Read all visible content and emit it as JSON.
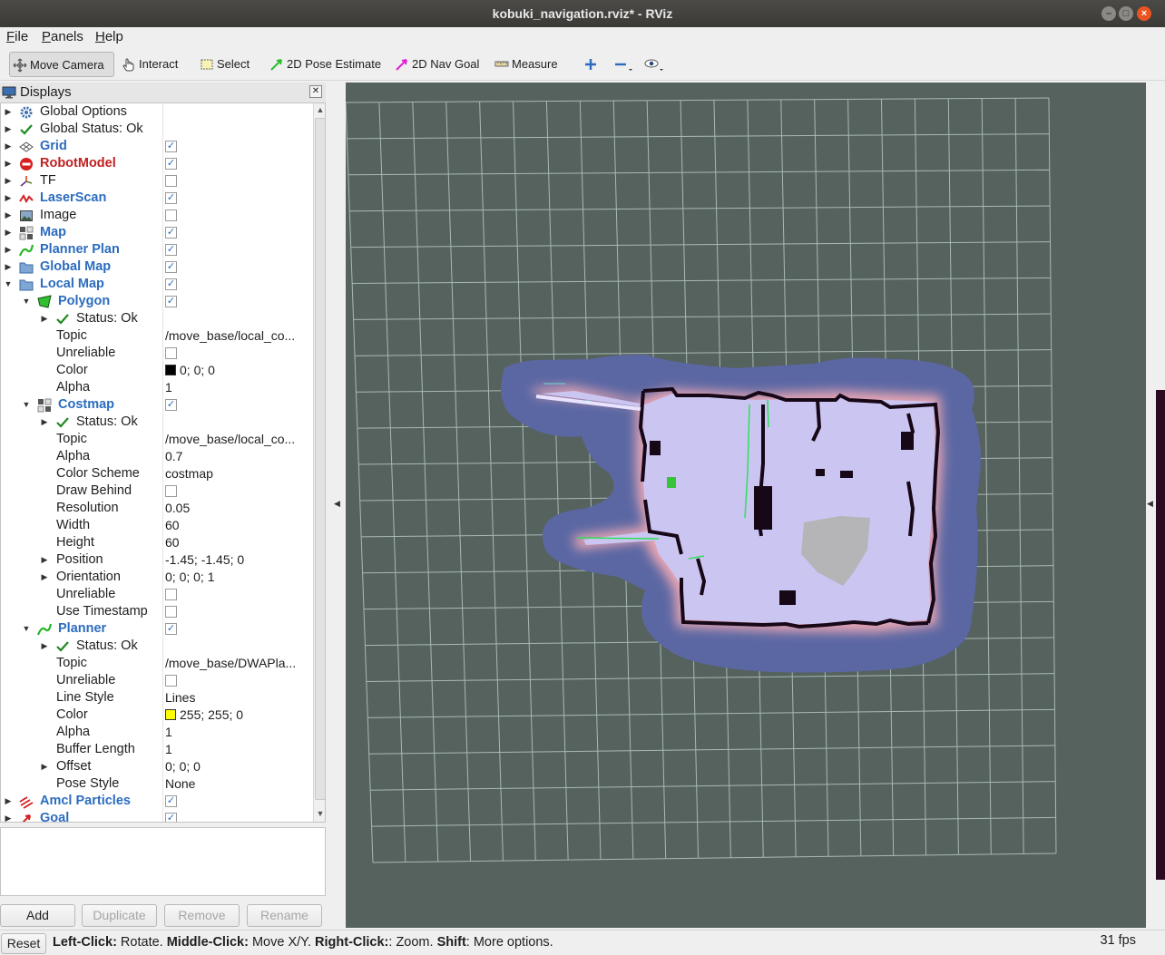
{
  "window": {
    "title": "kobuki_navigation.rviz* - RViz"
  },
  "menubar": [
    {
      "key": "F",
      "rest": "ile"
    },
    {
      "key": "P",
      "rest": "anels"
    },
    {
      "key": "H",
      "rest": "elp"
    }
  ],
  "toolbar": {
    "move_camera": "Move Camera",
    "interact": "Interact",
    "select": "Select",
    "pose_estimate": "2D Pose Estimate",
    "nav_goal": "2D Nav Goal",
    "measure": "Measure",
    "active_tool": "Move Camera"
  },
  "displays": {
    "title": "Displays",
    "rows": [
      {
        "depth": 0,
        "arrow": "right",
        "icon": "gear-icon",
        "label": "Global Options",
        "style": "",
        "value": "",
        "check": null
      },
      {
        "depth": 0,
        "arrow": "right",
        "icon": "check-icon",
        "label": "Global Status: Ok",
        "style": "",
        "value": "",
        "check": null
      },
      {
        "depth": 0,
        "arrow": "right",
        "icon": "grid-icon",
        "label": "Grid",
        "style": "blue",
        "value": "",
        "check": true
      },
      {
        "depth": 0,
        "arrow": "right",
        "icon": "robot-error-icon",
        "label": "RobotModel",
        "style": "red",
        "value": "",
        "check": true
      },
      {
        "depth": 0,
        "arrow": "right",
        "icon": "tf-icon",
        "label": "TF",
        "style": "",
        "value": "",
        "check": false
      },
      {
        "depth": 0,
        "arrow": "right",
        "icon": "laserscan-icon",
        "label": "LaserScan",
        "style": "blue",
        "value": "",
        "check": true
      },
      {
        "depth": 0,
        "arrow": "right",
        "icon": "image-icon",
        "label": "Image",
        "style": "",
        "value": "",
        "check": false
      },
      {
        "depth": 0,
        "arrow": "right",
        "icon": "map-icon",
        "label": "Map",
        "style": "blue",
        "value": "",
        "check": true
      },
      {
        "depth": 0,
        "arrow": "right",
        "icon": "path-icon",
        "label": "Planner Plan",
        "style": "blue",
        "value": "",
        "check": true
      },
      {
        "depth": 0,
        "arrow": "right",
        "icon": "folder-icon",
        "label": "Global Map",
        "style": "blue",
        "value": "",
        "check": true
      },
      {
        "depth": 0,
        "arrow": "down",
        "icon": "folder-icon",
        "label": "Local Map",
        "style": "blue",
        "value": "",
        "check": true
      },
      {
        "depth": 1,
        "arrow": "down",
        "icon": "polygon-icon",
        "label": "Polygon",
        "style": "blue",
        "value": "",
        "check": true
      },
      {
        "depth": 2,
        "arrow": "right",
        "icon": "check-icon",
        "label": "Status: Ok",
        "style": "",
        "value": "",
        "check": null
      },
      {
        "depth": 2,
        "arrow": "",
        "icon": "",
        "label": "Topic",
        "style": "",
        "value": "/move_base/local_co...",
        "check": null
      },
      {
        "depth": 2,
        "arrow": "",
        "icon": "",
        "label": "Unreliable",
        "style": "",
        "value": "",
        "check": false
      },
      {
        "depth": 2,
        "arrow": "",
        "icon": "",
        "label": "Color",
        "style": "",
        "value": "0; 0; 0",
        "swatch": "#000000",
        "check": null
      },
      {
        "depth": 2,
        "arrow": "",
        "icon": "",
        "label": "Alpha",
        "style": "",
        "value": "1",
        "check": null
      },
      {
        "depth": 1,
        "arrow": "down",
        "icon": "map-icon",
        "label": "Costmap",
        "style": "blue",
        "value": "",
        "check": true
      },
      {
        "depth": 2,
        "arrow": "right",
        "icon": "check-icon",
        "label": "Status: Ok",
        "style": "",
        "value": "",
        "check": null
      },
      {
        "depth": 2,
        "arrow": "",
        "icon": "",
        "label": "Topic",
        "style": "",
        "value": "/move_base/local_co...",
        "check": null
      },
      {
        "depth": 2,
        "arrow": "",
        "icon": "",
        "label": "Alpha",
        "style": "",
        "value": "0.7",
        "check": null
      },
      {
        "depth": 2,
        "arrow": "",
        "icon": "",
        "label": "Color Scheme",
        "style": "",
        "value": "costmap",
        "check": null
      },
      {
        "depth": 2,
        "arrow": "",
        "icon": "",
        "label": "Draw Behind",
        "style": "",
        "value": "",
        "check": false
      },
      {
        "depth": 2,
        "arrow": "",
        "icon": "",
        "label": "Resolution",
        "style": "",
        "value": "0.05",
        "check": null
      },
      {
        "depth": 2,
        "arrow": "",
        "icon": "",
        "label": "Width",
        "style": "",
        "value": "60",
        "check": null
      },
      {
        "depth": 2,
        "arrow": "",
        "icon": "",
        "label": "Height",
        "style": "",
        "value": "60",
        "check": null
      },
      {
        "depth": 2,
        "arrow": "right",
        "icon": "",
        "label": "Position",
        "style": "",
        "value": "-1.45; -1.45; 0",
        "check": null
      },
      {
        "depth": 2,
        "arrow": "right",
        "icon": "",
        "label": "Orientation",
        "style": "",
        "value": "0; 0; 0; 1",
        "check": null
      },
      {
        "depth": 2,
        "arrow": "",
        "icon": "",
        "label": "Unreliable",
        "style": "",
        "value": "",
        "check": false
      },
      {
        "depth": 2,
        "arrow": "",
        "icon": "",
        "label": "Use Timestamp",
        "style": "",
        "value": "",
        "check": false
      },
      {
        "depth": 1,
        "arrow": "down",
        "icon": "path-icon",
        "label": "Planner",
        "style": "blue",
        "value": "",
        "check": true
      },
      {
        "depth": 2,
        "arrow": "right",
        "icon": "check-icon",
        "label": "Status: Ok",
        "style": "",
        "value": "",
        "check": null
      },
      {
        "depth": 2,
        "arrow": "",
        "icon": "",
        "label": "Topic",
        "style": "",
        "value": "/move_base/DWAPla...",
        "check": null
      },
      {
        "depth": 2,
        "arrow": "",
        "icon": "",
        "label": "Unreliable",
        "style": "",
        "value": "",
        "check": false
      },
      {
        "depth": 2,
        "arrow": "",
        "icon": "",
        "label": "Line Style",
        "style": "",
        "value": "Lines",
        "check": null
      },
      {
        "depth": 2,
        "arrow": "",
        "icon": "",
        "label": "Color",
        "style": "",
        "value": "255; 255; 0",
        "swatch": "#ffff00",
        "check": null
      },
      {
        "depth": 2,
        "arrow": "",
        "icon": "",
        "label": "Alpha",
        "style": "",
        "value": "1",
        "check": null
      },
      {
        "depth": 2,
        "arrow": "",
        "icon": "",
        "label": "Buffer Length",
        "style": "",
        "value": "1",
        "check": null
      },
      {
        "depth": 2,
        "arrow": "right",
        "icon": "",
        "label": "Offset",
        "style": "",
        "value": "0; 0; 0",
        "check": null
      },
      {
        "depth": 2,
        "arrow": "",
        "icon": "",
        "label": "Pose Style",
        "style": "",
        "value": "None",
        "check": null
      },
      {
        "depth": 0,
        "arrow": "right",
        "icon": "particles-icon",
        "label": "Amcl Particles",
        "style": "blue",
        "value": "",
        "check": true
      },
      {
        "depth": 0,
        "arrow": "right",
        "icon": "goal-icon",
        "label": "Goal",
        "style": "blue",
        "value": "",
        "check": true
      }
    ],
    "buttons": {
      "add": "Add",
      "duplicate": "Duplicate",
      "remove": "Remove",
      "rename": "Rename"
    }
  },
  "statusbar": {
    "reset": "Reset",
    "parts": [
      {
        "text": "Left-Click:",
        "bold": true
      },
      {
        "text": " Rotate. ",
        "bold": false
      },
      {
        "text": "Middle-Click:",
        "bold": true
      },
      {
        "text": " Move X/Y. ",
        "bold": false
      },
      {
        "text": "Right-Click:",
        "bold": true
      },
      {
        "text": ": Zoom. ",
        "bold": false
      },
      {
        "text": "Shift",
        "bold": true
      },
      {
        "text": ": More options.",
        "bold": false
      }
    ],
    "fps": "31 fps"
  },
  "colors": {
    "viewport_bg": "#56625e",
    "grid_line": "#a9b8b3",
    "inflation": "#5d6aa6",
    "free_space": "#c9c3f0",
    "obstacle": "#160818",
    "unknown_patch": "#b6b6b6",
    "link_blue": "#2b6cbf",
    "error_red": "#c02020"
  }
}
